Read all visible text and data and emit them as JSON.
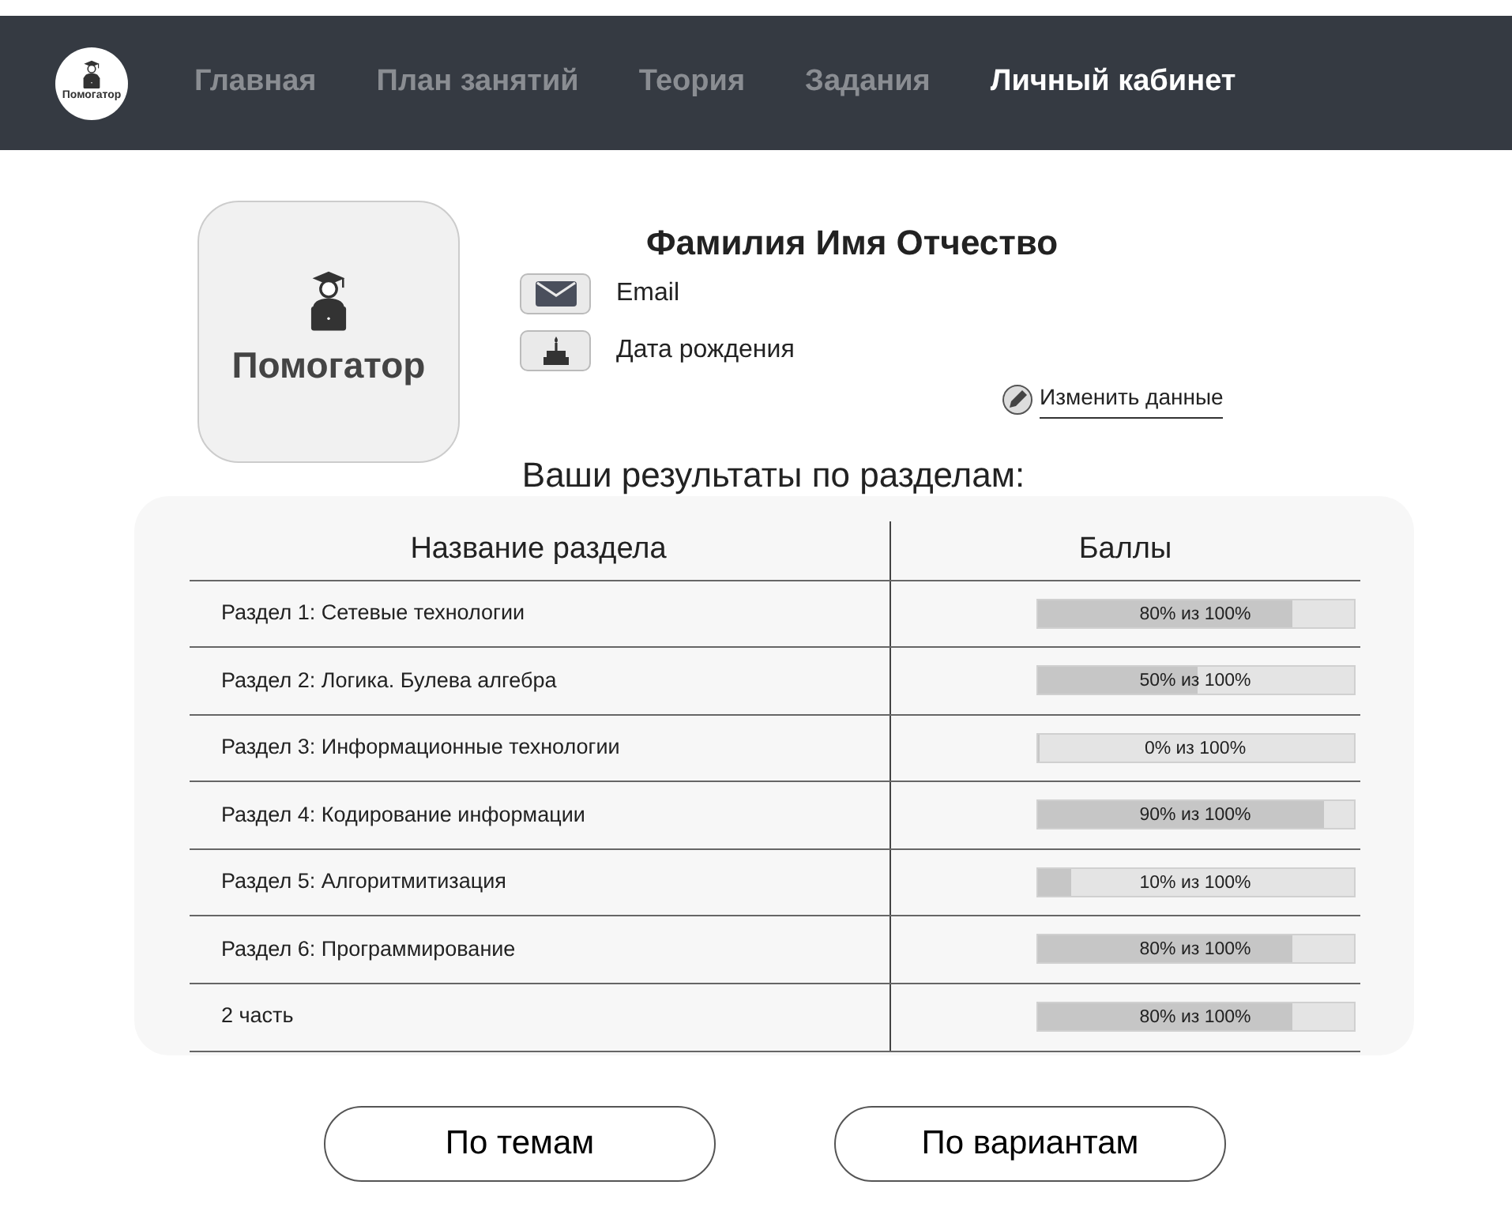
{
  "navbar": {
    "logo_text": "Помогатор",
    "items": [
      {
        "label": "Главная",
        "selected": false
      },
      {
        "label": "План занятий",
        "selected": false
      },
      {
        "label": "Теория",
        "selected": false
      },
      {
        "label": "Задания",
        "selected": false
      },
      {
        "label": "Личный кабинет",
        "selected": true
      }
    ]
  },
  "profile": {
    "avatar_text": "Помогатор",
    "name": "Фамилия Имя Отчество",
    "fields": [
      {
        "kind": "email",
        "label": "Email"
      },
      {
        "kind": "birthday",
        "label": "Дата рождения"
      }
    ],
    "edit_link": "Изменить данные"
  },
  "results": {
    "title": "Ваши результаты по разделам:",
    "columns": [
      "Название раздела",
      "Баллы"
    ],
    "rows": [
      {
        "section": "Раздел 1: Сетевые технологии",
        "level": 0.8,
        "score": "80% из 100%"
      },
      {
        "section": "Раздел 2: Логика. Булева алгебра",
        "level": 0.5,
        "score": "50% из 100%"
      },
      {
        "section": "Раздел 3: Информационные технологии",
        "level": 0,
        "score": "0% из 100%"
      },
      {
        "section": "Раздел 4: Кодирование информации",
        "level": 0.9,
        "score": "90% из 100%"
      },
      {
        "section": "Раздел 5: Алгоритмитизация",
        "level": 0.1,
        "score": "10% из 100%"
      },
      {
        "section": "Раздел 6: Программирование",
        "level": 0.8,
        "score": "80% из 100%"
      },
      {
        "section": "2 часть",
        "level": 0.8,
        "score": "80% из 100%"
      }
    ]
  },
  "buttons": [
    "По темам",
    "По вариантам"
  ]
}
